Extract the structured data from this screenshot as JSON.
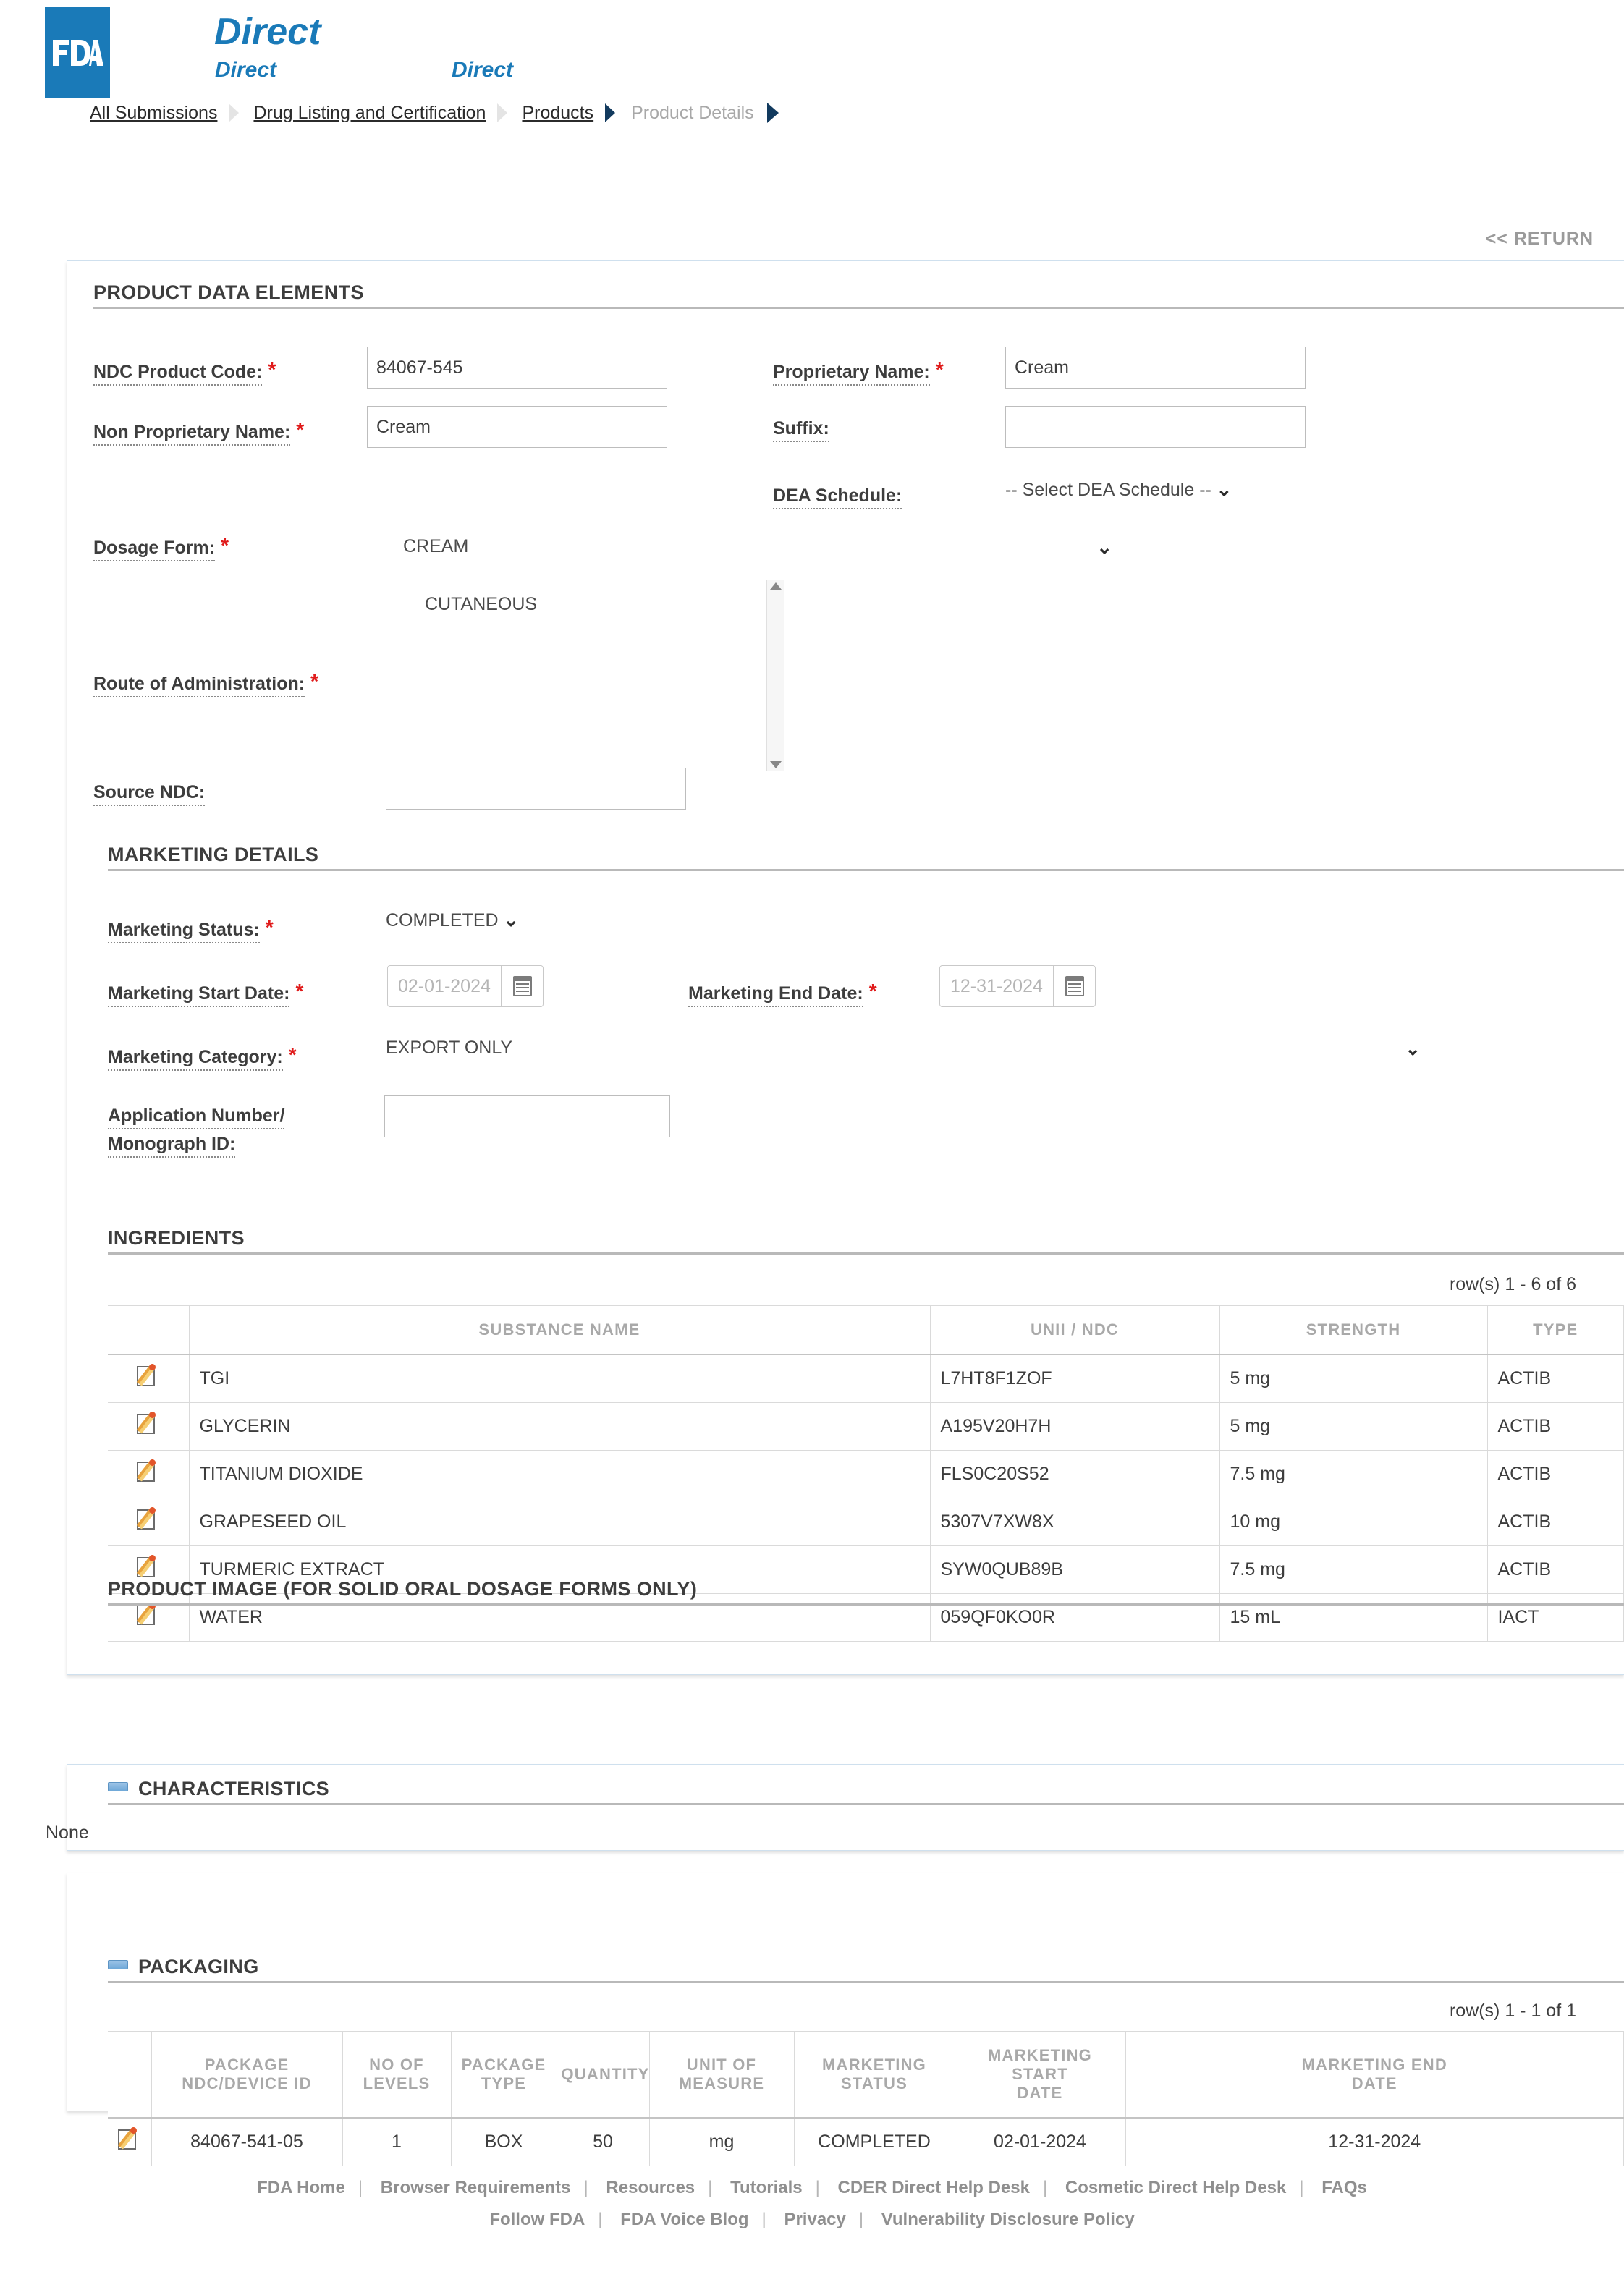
{
  "header": {
    "logo_text": "FDA",
    "brand_main": "Direct",
    "brand_sub1": "Direct",
    "brand_sub2": "Direct"
  },
  "breadcrumb": {
    "items": [
      {
        "label": "All Submissions",
        "current": false
      },
      {
        "label": "Drug Listing and Certification",
        "current": false
      },
      {
        "label": "Products",
        "current": false
      },
      {
        "label": "Product Details",
        "current": true
      }
    ]
  },
  "return_link": "<< RETURN",
  "product_data_elements": {
    "section_title": "PRODUCT DATA ELEMENTS",
    "ndc_product_code": {
      "label": "NDC Product Code:",
      "required": true,
      "value": "84067-545"
    },
    "proprietary_name": {
      "label": "Proprietary Name:",
      "required": true,
      "value": "Cream"
    },
    "non_proprietary_name": {
      "label": "Non Proprietary Name:",
      "required": true,
      "value": "Cream"
    },
    "suffix": {
      "label": "Suffix:",
      "required": false,
      "value": ""
    },
    "dea_schedule": {
      "label": "DEA Schedule:",
      "required": false,
      "value": "-- Select DEA Schedule --"
    },
    "dosage_form": {
      "label": "Dosage Form:",
      "required": true,
      "value": "CREAM"
    },
    "route_of_administration": {
      "label": "Route of Administration:",
      "required": true,
      "value": "CUTANEOUS"
    },
    "source_ndc": {
      "label": "Source NDC:",
      "required": false,
      "value": ""
    }
  },
  "marketing_details": {
    "section_title": "MARKETING DETAILS",
    "marketing_status": {
      "label": "Marketing Status:",
      "required": true,
      "value": "COMPLETED"
    },
    "marketing_start_date": {
      "label": "Marketing Start Date:",
      "required": true,
      "value": "02-01-2024"
    },
    "marketing_end_date": {
      "label": "Marketing End Date:",
      "required": true,
      "value": "12-31-2024"
    },
    "marketing_category": {
      "label": "Marketing Category:",
      "required": true,
      "value": "EXPORT ONLY"
    },
    "application_number": {
      "label_line1": "Application Number/",
      "label_line2": "Monograph ID:",
      "required": false,
      "value": ""
    }
  },
  "ingredients": {
    "section_title": "INGREDIENTS",
    "rowcount": "row(s) 1 - 6 of 6",
    "columns": [
      "",
      "SUBSTANCE NAME",
      "UNII / NDC",
      "STRENGTH",
      "TYPE"
    ],
    "rows": [
      {
        "substance_name": "TGI",
        "unii_ndc": "L7HT8F1ZOF",
        "strength": "5 mg",
        "type": "ACTIB"
      },
      {
        "substance_name": "GLYCERIN",
        "unii_ndc": "A195V20H7H",
        "strength": "5 mg",
        "type": "ACTIB"
      },
      {
        "substance_name": "TITANIUM DIOXIDE",
        "unii_ndc": "FLS0C20S52",
        "strength": "7.5 mg",
        "type": "ACTIB"
      },
      {
        "substance_name": "GRAPESEED OIL",
        "unii_ndc": "5307V7XW8X",
        "strength": "10 mg",
        "type": "ACTIB"
      },
      {
        "substance_name": "TURMERIC EXTRACT",
        "unii_ndc": "SYW0QUB89B",
        "strength": "7.5 mg",
        "type": "ACTIB"
      },
      {
        "substance_name": "WATER",
        "unii_ndc": "059QF0KO0R",
        "strength": "15 mL",
        "type": "IACT"
      }
    ]
  },
  "product_image": {
    "section_title": "PRODUCT IMAGE (FOR SOLID ORAL DOSAGE FORMS ONLY)"
  },
  "characteristics": {
    "section_title": "CHARACTERISTICS",
    "body": "None"
  },
  "packaging": {
    "section_title": "PACKAGING",
    "rowcount": "row(s) 1 - 1 of 1",
    "columns": [
      "",
      "PACKAGE NDC/DEVICE ID",
      "NO OF LEVELS",
      "PACKAGE TYPE",
      "QUANTITY",
      "UNIT OF MEASURE",
      "MARKETING STATUS",
      "MARKETING START DATE",
      "MARKETING END DATE"
    ],
    "col_lines": [
      [
        "",
        ""
      ],
      [
        "PACKAGE",
        "NDC/DEVICE ID"
      ],
      [
        "NO OF",
        "LEVELS"
      ],
      [
        "PACKAGE",
        "TYPE"
      ],
      [
        "QUANTITY",
        ""
      ],
      [
        "UNIT OF",
        "MEASURE"
      ],
      [
        "MARKETING",
        "STATUS"
      ],
      [
        "MARKETING START",
        "DATE"
      ],
      [
        "MARKETING END",
        "DATE"
      ]
    ],
    "rows": [
      {
        "package_ndc": "84067-541-05",
        "no_of_levels": "1",
        "package_type": "BOX",
        "quantity": "50",
        "unit_of_measure": "mg",
        "marketing_status": "COMPLETED",
        "marketing_start_date": "02-01-2024",
        "marketing_end_date": "12-31-2024"
      }
    ]
  },
  "footer": {
    "row1": [
      "FDA Home",
      "Browser Requirements",
      "Resources",
      "Tutorials",
      "CDER Direct Help Desk",
      "Cosmetic Direct Help Desk",
      "FAQs"
    ],
    "row2": [
      "Follow FDA",
      "FDA Voice Blog",
      "Privacy",
      "Vulnerability Disclosure Policy"
    ],
    "separator": "|"
  },
  "colors": {
    "brand_blue": "#1a7ab8",
    "required_red": "#e01b1b",
    "panel_border": "#cfe0ee",
    "muted_gray": "#a9a9a9"
  }
}
